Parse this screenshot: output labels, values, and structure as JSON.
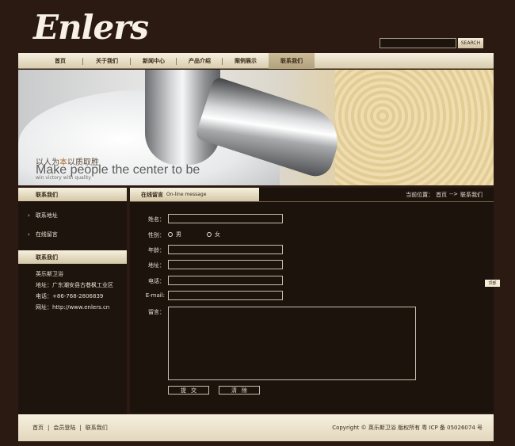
{
  "header": {
    "logo": "Enlers",
    "search_placeholder": "",
    "search_button": "SEARCH"
  },
  "nav": {
    "items": [
      {
        "label": "首页"
      },
      {
        "label": "关于我们"
      },
      {
        "label": "新闻中心"
      },
      {
        "label": "产品介绍"
      },
      {
        "label": "案例展示"
      },
      {
        "label": "联系我们"
      }
    ],
    "active_index": 5
  },
  "banner": {
    "slogan_cn_prefix": "以人为",
    "slogan_cn_highlight": "本",
    "slogan_cn_suffix": "以质取胜",
    "slogan_en": "Make people the center to be",
    "slogan_small": "win victory with quality"
  },
  "sidebar": {
    "menu_title": "联系我们",
    "menu_items": [
      {
        "label": "联系地址"
      },
      {
        "label": "在线留言"
      }
    ],
    "contact_title": "联系我们",
    "contact_lines": [
      "英乐斯卫浴",
      "地址：广东潮安县古巷枫工业区",
      "电话：+86-768-2806839",
      "网址：http://www.enlers.cn"
    ]
  },
  "main": {
    "tab_title_cn": "在线留言",
    "tab_title_en": "On-line message",
    "breadcrumb": {
      "prefix": "当前位置：",
      "home": "首页",
      "arrow": "-->",
      "current": "联系我们"
    },
    "form": {
      "name_label": "姓名：",
      "gender_label": "性别：",
      "gender_male": "男",
      "gender_female": "女",
      "age_label": "年龄：",
      "address_label": "地址：",
      "phone_label": "电话：",
      "email_label": "E-mail:",
      "message_label": "留言：",
      "submit_label": "提交",
      "clear_label": "清除"
    }
  },
  "scroll_tab": "顶部",
  "footer": {
    "links": [
      {
        "label": "首页"
      },
      {
        "label": "会员登陆"
      },
      {
        "label": "联系我们"
      }
    ],
    "separator": "|",
    "copyright": "Copyright © 英乐斯卫浴 版权所有 粤 ICP 备 05026074 号"
  },
  "colors": {
    "background": "#2a1a12",
    "panel": "#1c130d",
    "nav_gradient_top": "#f6f0de",
    "nav_gradient_bottom": "#d9cdaf",
    "text_light": "#e9e1d2",
    "text_dark": "#3a2a1a"
  }
}
